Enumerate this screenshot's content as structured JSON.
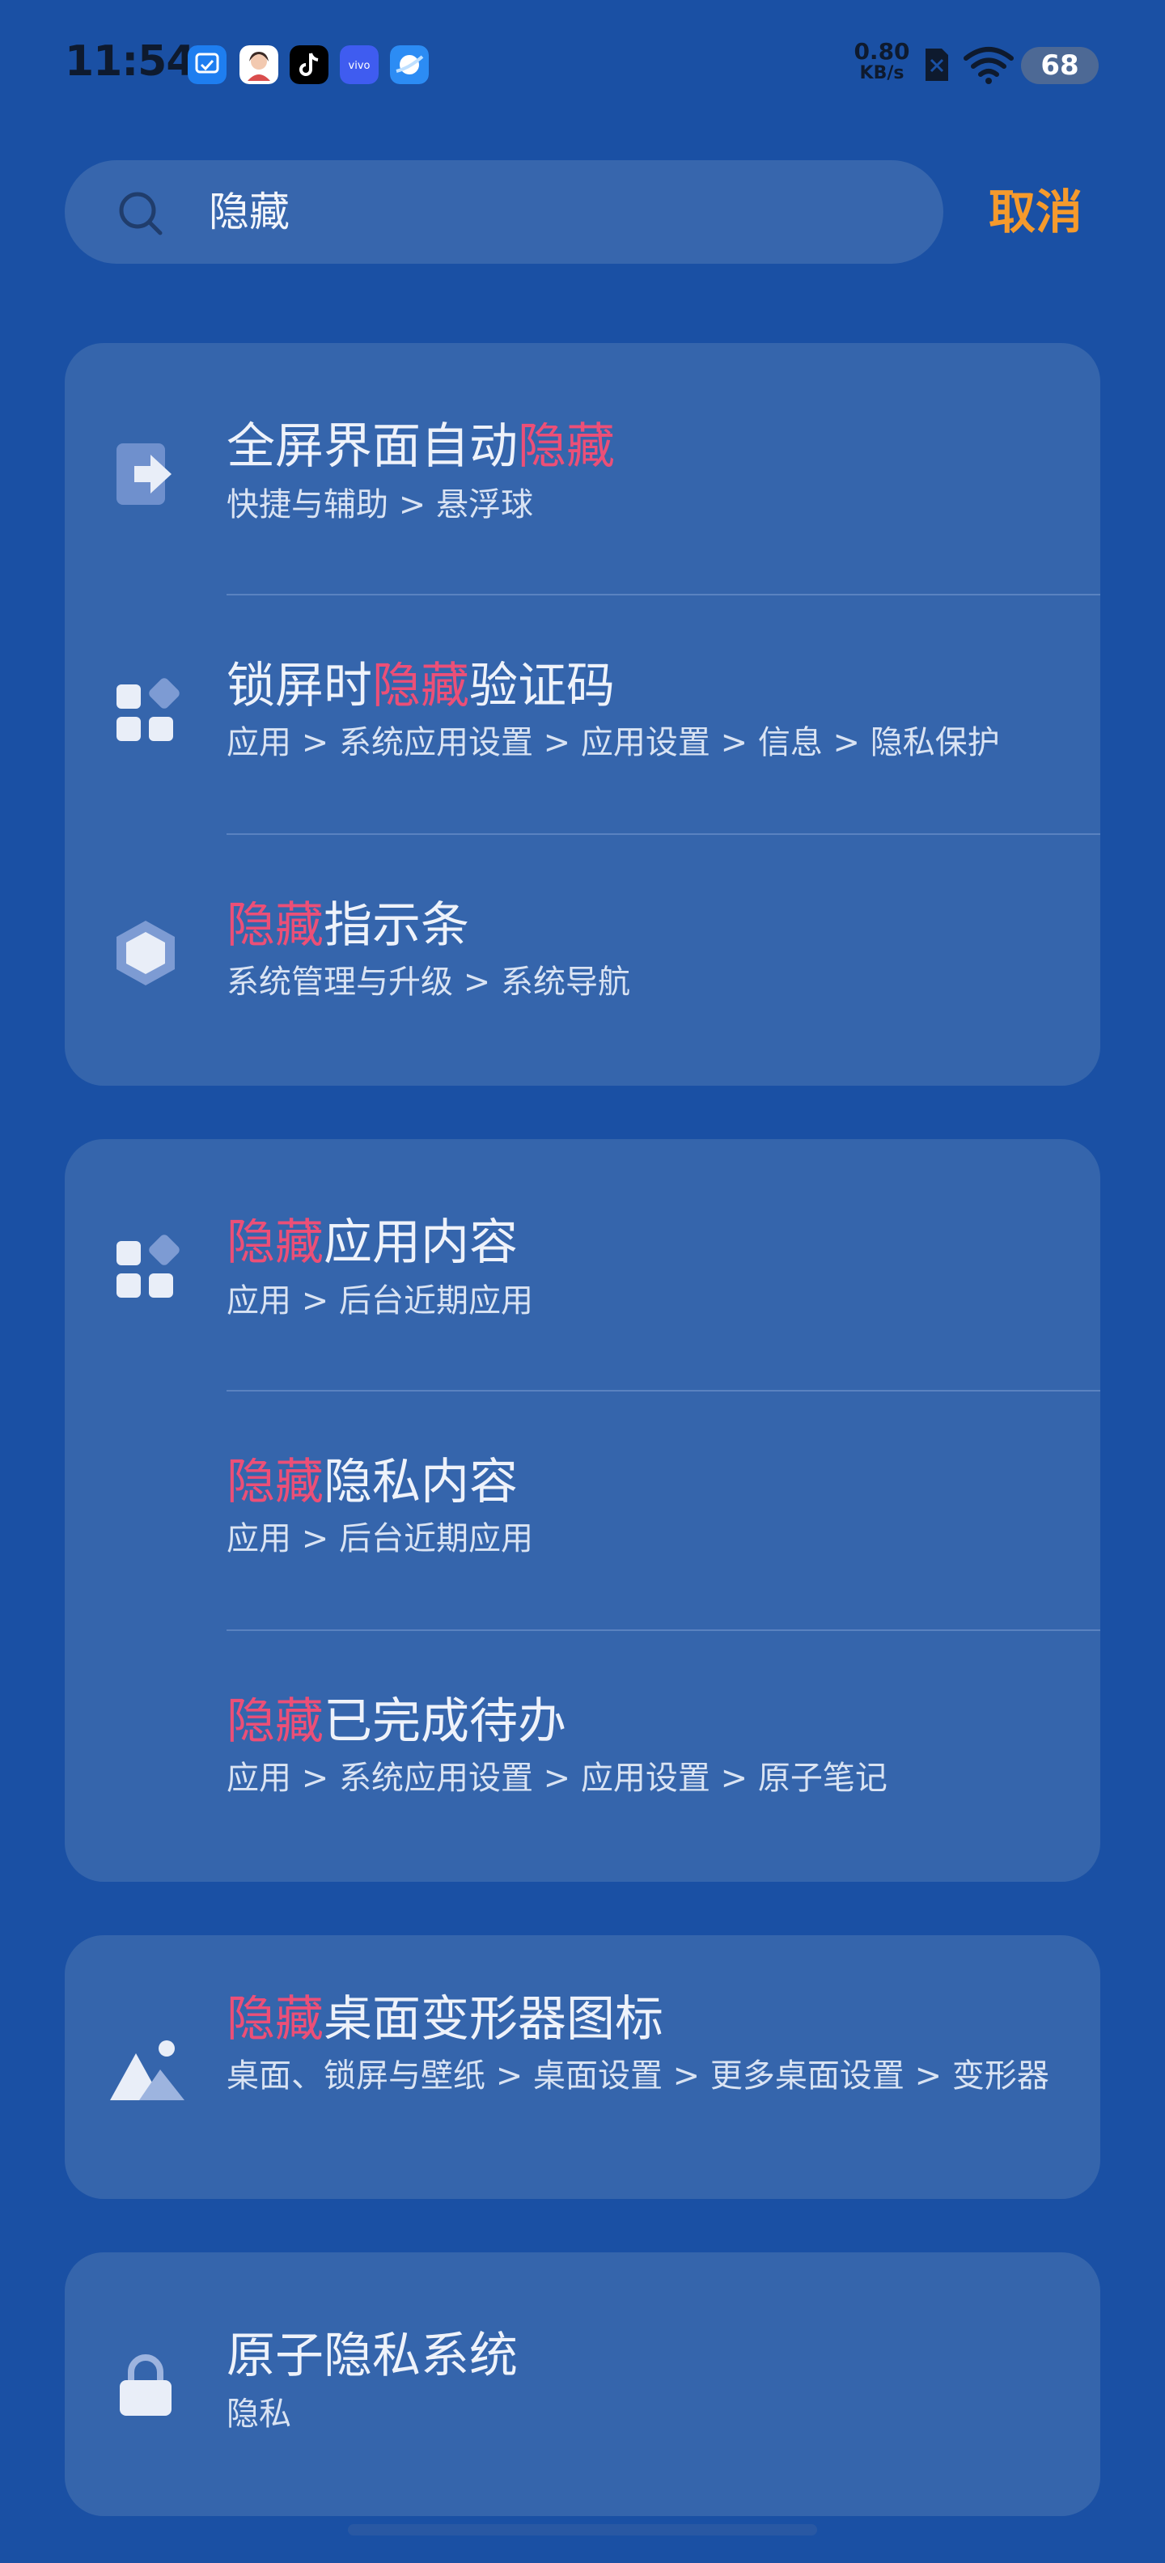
{
  "status_bar": {
    "time": "11:54",
    "net_speed_value": "0.80",
    "net_speed_unit": "KB/s",
    "battery": "68",
    "icons": [
      "screenshot-app-icon",
      "avatar-app-icon",
      "tiktok-app-icon",
      "vivo-app-icon",
      "browser-app-icon",
      "sim-disabled-icon",
      "wifi-icon",
      "battery-icon"
    ]
  },
  "search": {
    "query": "隐藏",
    "cancel_label": "取消"
  },
  "colors": {
    "background": "#1a50a4",
    "card": "#3565ac",
    "highlight": "#ec4f77",
    "cancel": "#f59a2c"
  },
  "results": {
    "group1": [
      {
        "title_pre": "全屏界面自动",
        "title_hl": "隐藏",
        "title_post": "",
        "path": "快捷与辅助 > 悬浮球",
        "icon": "arrow-right-icon"
      },
      {
        "title_pre": "锁屏时",
        "title_hl": "隐藏",
        "title_post": "验证码",
        "path": "应用 > 系统应用设置 > 应用设置 > 信息 > 隐私保护",
        "icon": "apps-grid-icon"
      },
      {
        "title_pre": "",
        "title_hl": "隐藏",
        "title_post": "指示条",
        "path": "系统管理与升级 > 系统导航",
        "icon": "hexagon-icon"
      }
    ],
    "group2": [
      {
        "title_pre": "",
        "title_hl": "隐藏",
        "title_post": "应用内容",
        "path": "应用 > 后台近期应用",
        "icon": "apps-grid-icon"
      },
      {
        "title_pre": "",
        "title_hl": "隐藏",
        "title_post": "隐私内容",
        "path": "应用 > 后台近期应用",
        "icon": ""
      },
      {
        "title_pre": "",
        "title_hl": "隐藏",
        "title_post": "已完成待办",
        "path": "应用 > 系统应用设置 > 应用设置 > 原子笔记",
        "icon": ""
      }
    ],
    "group3": [
      {
        "title_pre": "",
        "title_hl": "隐藏",
        "title_post": "桌面变形器图标",
        "path": "桌面、锁屏与壁纸 > 桌面设置 > 更多桌面设置 > 变形器",
        "icon": "wallpaper-icon"
      }
    ],
    "group4": [
      {
        "title_pre": "原子隐私系统",
        "title_hl": "",
        "title_post": "",
        "path": "隐私",
        "icon": "lock-icon"
      }
    ]
  }
}
